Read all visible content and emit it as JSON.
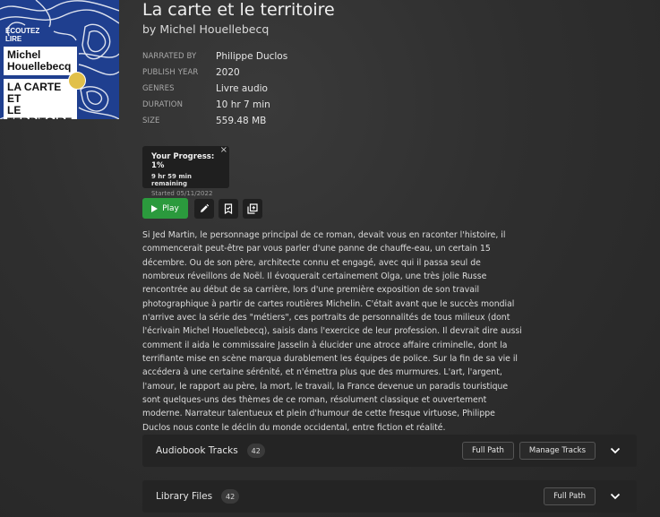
{
  "cover": {
    "badge_line1": "ÉCOUTEZ",
    "badge_line2": "LIRE",
    "author_line1": "Michel",
    "author_line2": "Houellebecq",
    "title_line1": "LA CARTE ET",
    "title_line2": "LE TERRITOIRE",
    "colors": {
      "background": "#1f3f8f",
      "lines": "#ffffff",
      "seal": "#e1c04a"
    }
  },
  "book": {
    "title": "La carte et le territoire",
    "by_label": "by",
    "author": "Michel Houellebecq"
  },
  "meta": [
    {
      "label": "NARRATED BY",
      "value": "Philippe Duclos"
    },
    {
      "label": "PUBLISH YEAR",
      "value": "2020"
    },
    {
      "label": "GENRES",
      "value": "Livre audio"
    },
    {
      "label": "DURATION",
      "value": "10 hr 7 min"
    },
    {
      "label": "SIZE",
      "value": "559.48 MB"
    }
  ],
  "progress": {
    "title": "Your Progress: 1%",
    "remaining": "9 hr 59 min remaining",
    "started": "Started 05/11/2022",
    "close_icon": "×"
  },
  "actions": {
    "play_label": "Play",
    "icons": [
      "pencil-icon",
      "bookmark-check-icon",
      "collection-icon"
    ],
    "colors": {
      "play": "#2b9a3d"
    }
  },
  "description": "Si Jed Martin, le personnage principal de ce roman, devait vous en raconter l'histoire, il commencerait peut-être par vous parler d'une panne de chauffe-eau, un certain 15 décembre. Ou de son père, architecte connu et engagé, avec qui il passa seul de nombreux réveillons de Noël. Il évoquerait certainement Olga, une très jolie Russe rencontrée au début de sa carrière, lors d'une première exposition de son travail photographique à partir de cartes routières Michelin. C'était avant que le succès mondial n'arrive avec la série des \"métiers\", ces portraits de personnalités de tous milieux (dont l'écrivain Michel Houellebecq), saisis dans l'exercice de leur profession. Il devrait dire aussi comment il aida le commissaire Jasselin à élucider une atroce affaire criminelle, dont la terrifiante mise en scène marqua durablement les équipes de police. Sur la fin de sa vie il accédera à une certaine sérénité, et n'émettra plus que des murmures. L'art, l'argent, l'amour, le rapport au père, la mort, le travail, la France devenue un paradis touristique sont quelques-uns des thèmes de ce roman, résolument classique et ouvertement moderne. Narrateur talentueux et plein d'humour de cette fresque virtuose, Philippe Duclos nous conte le déclin du monde occidental, entre fiction et réalité.",
  "tracks_panel": {
    "label": "Audiobook Tracks",
    "count": "42",
    "full_path_label": "Full Path",
    "manage_label": "Manage Tracks"
  },
  "files_panel": {
    "label": "Library Files",
    "count": "42",
    "full_path_label": "Full Path"
  }
}
